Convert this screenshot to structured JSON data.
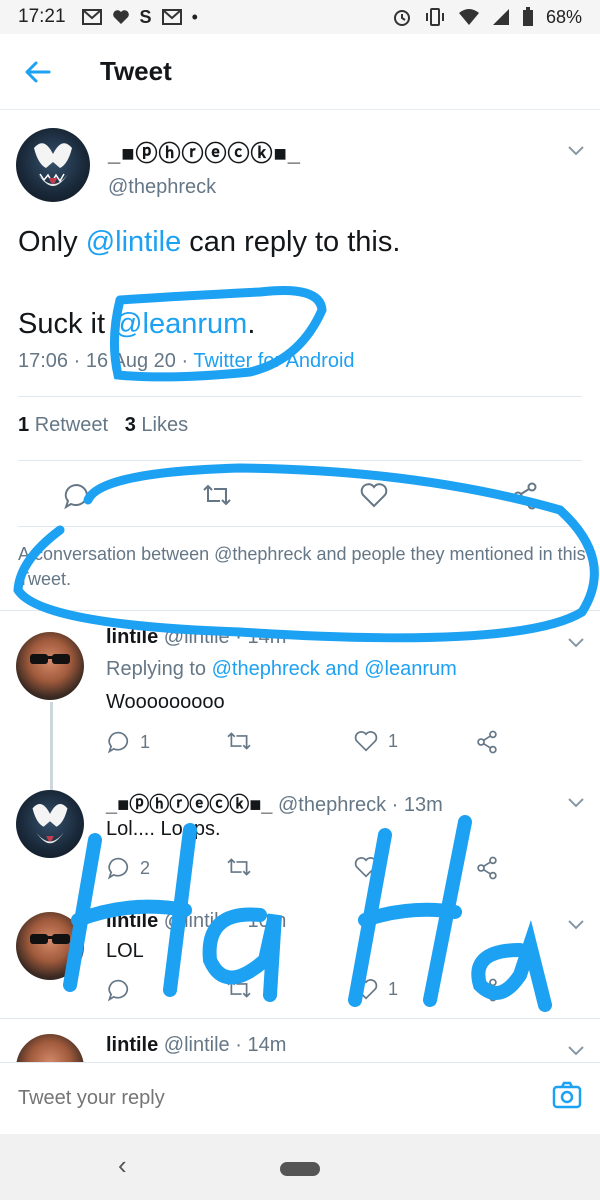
{
  "status_bar": {
    "time": "17:21",
    "left_icons": [
      "gmail-icon",
      "heart-icon",
      "s-icon",
      "gmail-icon",
      "dot-icon"
    ],
    "battery": "68%"
  },
  "header": {
    "title": "Tweet"
  },
  "main_tweet": {
    "display_name": "_■ⓟⓗⓡⓔⓒⓚ■_",
    "handle": "@thephreck",
    "text_line1_prefix": "Only ",
    "text_line1_mention": "@lintile",
    "text_line1_suffix": " can reply to this.",
    "text_line2_prefix": "Suck it ",
    "text_line2_mention": "@leanrum",
    "text_line2_suffix": ".",
    "timestamp": "17:06 · 16 Aug 20 · ",
    "source": "Twitter for Android",
    "retweet_count": "1",
    "retweet_label": "Retweet",
    "like_count": "3",
    "like_label": "Likes"
  },
  "conversation_note": "A conversation between @thephreck and people they mentioned in this Tweet.",
  "replies": [
    {
      "name": "lintile",
      "meta": " @lintile · 14m",
      "replying_label": "Replying to ",
      "replying_mentions": "@thephreck and @leanrum",
      "text": "Wooooooooo",
      "reply_count": "1",
      "like_count": "1"
    },
    {
      "name": "_■ⓟⓗⓡⓔⓒⓚ■_",
      "meta": " @thephreck · 13m",
      "text": "Lol.... Loops.",
      "reply_count": "2",
      "like_count": ""
    },
    {
      "name": "lintile",
      "meta": " @lintile · 10m",
      "text": "LOL",
      "reply_count": "",
      "like_count": "1"
    },
    {
      "name": "lintile",
      "meta": " @lintile · 14m"
    }
  ],
  "composer": {
    "placeholder": "Tweet your reply"
  },
  "annotation": {
    "scribble_text": "HaHa",
    "color": "#1da1f2"
  },
  "colors": {
    "accent": "#1da1f2",
    "muted": "#657786",
    "text": "#14171a"
  }
}
